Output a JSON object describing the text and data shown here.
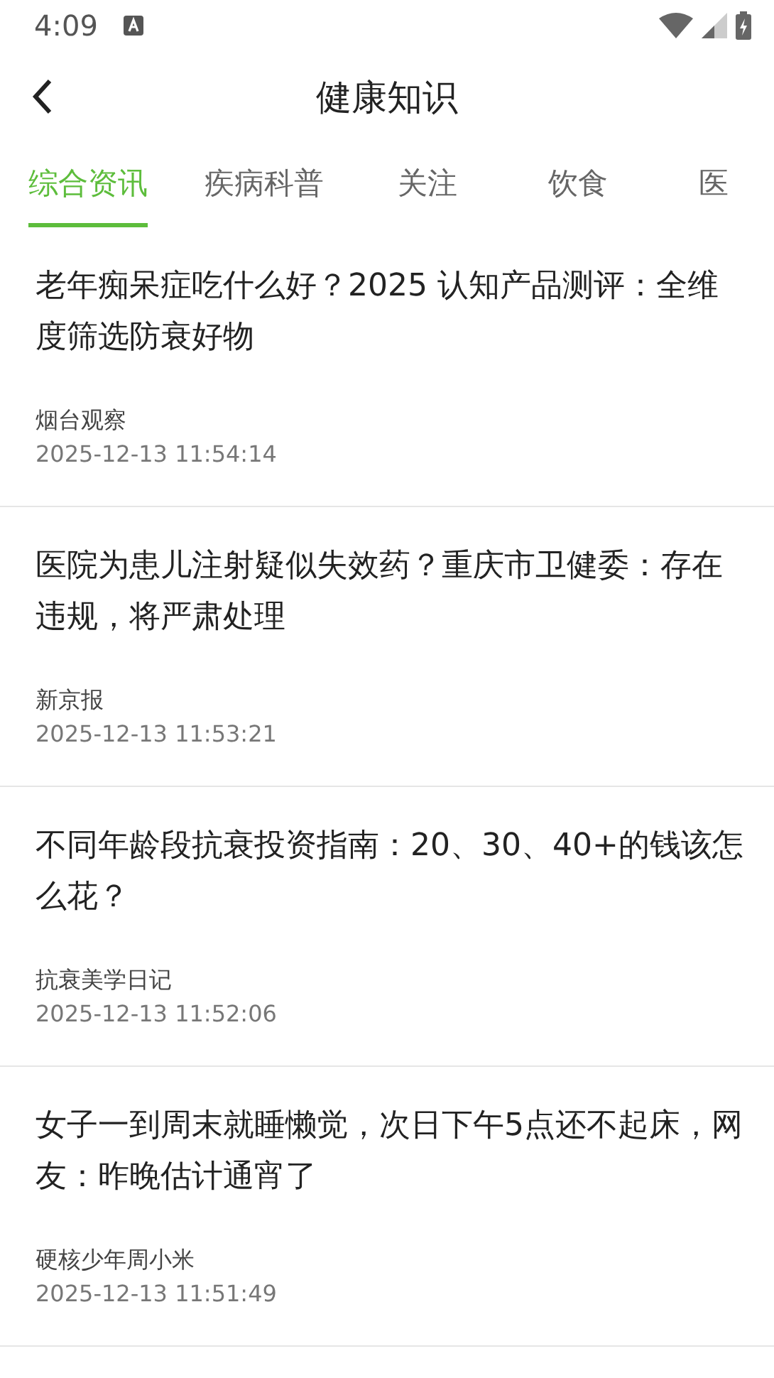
{
  "status_bar": {
    "time": "4:09"
  },
  "header": {
    "title": "健康知识"
  },
  "tabs": [
    {
      "label": "综合资讯",
      "selected": true
    },
    {
      "label": "疾病科普",
      "selected": false
    },
    {
      "label": "关注",
      "selected": false
    },
    {
      "label": "饮食",
      "selected": false
    },
    {
      "label": "医",
      "selected": false
    }
  ],
  "articles": [
    {
      "title": "老年痴呆症吃什么好？2025 认知产品测评：全维度筛选防衰好物",
      "source": "烟台观察",
      "time": "2025-12-13 11:54:14"
    },
    {
      "title": "医院为患儿注射疑似失效药？重庆市卫健委：存在违规，将严肃处理",
      "source": "新京报",
      "time": "2025-12-13 11:53:21"
    },
    {
      "title": "不同年龄段抗衰投资指南：20、30、40+的钱该怎么花？",
      "source": "抗衰美学日记",
      "time": "2025-12-13 11:52:06"
    },
    {
      "title": "女子一到周末就睡懒觉，次日下午5点还不起床，网友：昨晚估计通宵了",
      "source": "硬核少年周小米",
      "time": "2025-12-13 11:51:49"
    }
  ]
}
